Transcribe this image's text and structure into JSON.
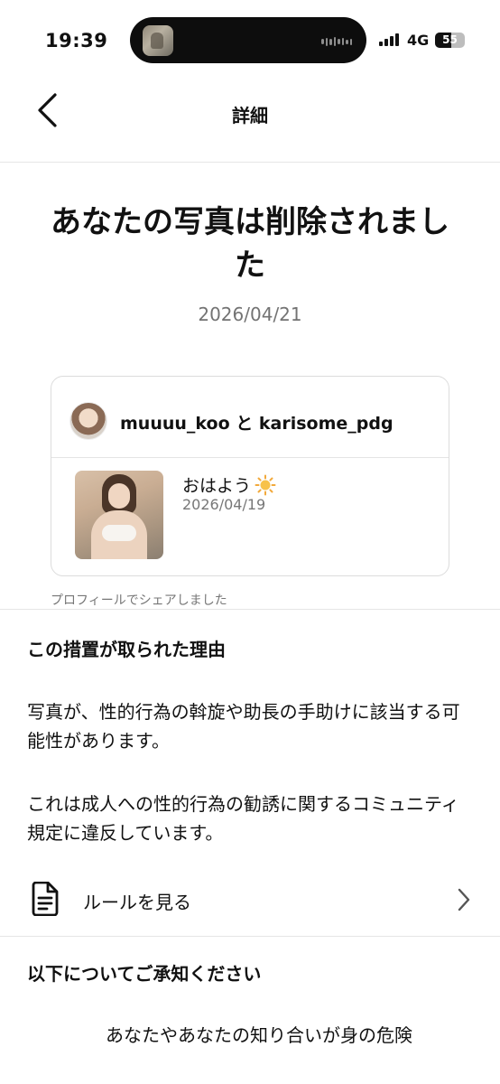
{
  "status_bar": {
    "time": "19:39",
    "network": "4G",
    "battery": "55",
    "battery_level_pct": 55
  },
  "header": {
    "back_icon": "chevron-left-icon",
    "title": "詳細"
  },
  "main": {
    "headline": "あなたの写真は削除されました",
    "date": "2026/04/21",
    "card": {
      "users": "muuuu_koo と karisome_pdg",
      "caption": "おはよう",
      "caption_emoji": "sun-emoji",
      "post_date": "2026/04/19"
    },
    "share_note": "プロフィールでシェアしました"
  },
  "reason": {
    "title": "この措置が取られた理由",
    "paragraph1": "写真が、性的行為の斡旋や助長の手助けに該当する可能性があります。",
    "paragraph2": "これは成人への性的行為の勧誘に関するコミュニティ規定に違反しています。",
    "rules_label": "ルールを見る",
    "rules_icon": "document-icon"
  },
  "notice": {
    "title": "以下についてご承知ください",
    "text": "あなたやあなたの知り合いが身の危険"
  }
}
